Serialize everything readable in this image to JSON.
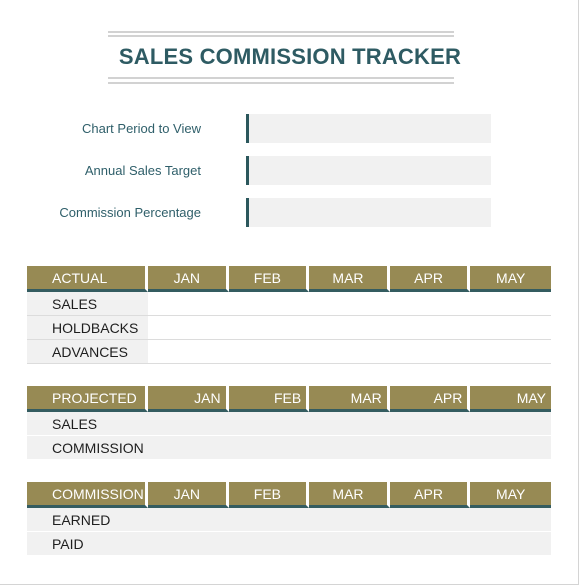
{
  "title": "SALES COMMISSION TRACKER",
  "settings": [
    {
      "label": "Chart Period to View",
      "value": ""
    },
    {
      "label": "Annual Sales Target",
      "value": ""
    },
    {
      "label": "Commission Percentage",
      "value": ""
    }
  ],
  "tables": {
    "actual": {
      "header": "ACTUAL",
      "months": [
        "JAN",
        "FEB",
        "MAR",
        "APR",
        "MAY"
      ],
      "rows": [
        "SALES",
        "HOLDBACKS",
        "ADVANCES"
      ]
    },
    "projected": {
      "header": "PROJECTED",
      "months": [
        "JAN",
        "FEB",
        "MAR",
        "APR",
        "MAY"
      ],
      "rows": [
        "SALES",
        "COMMISSION"
      ]
    },
    "commission": {
      "header": "COMMISSION",
      "months": [
        "JAN",
        "FEB",
        "MAR",
        "APR",
        "MAY"
      ],
      "rows": [
        "EARNED",
        "PAID"
      ]
    }
  },
  "colors": {
    "header_fill": "#978a54",
    "accent": "#2e5b63",
    "cell_fill": "#f1f1f1"
  }
}
